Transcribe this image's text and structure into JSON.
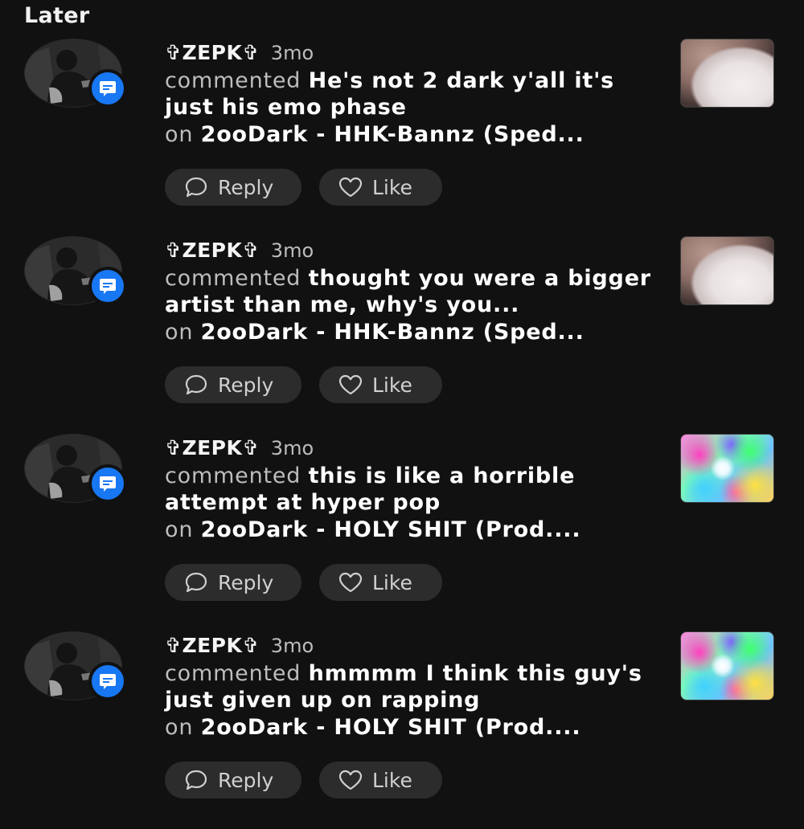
{
  "section": {
    "title": "Later"
  },
  "colors": {
    "background": "#111111",
    "badge": "#1877f2",
    "button_bg": "#2c2c2c",
    "muted_text": "#bdbdbd"
  },
  "notifications": [
    {
      "username": "✞ZEPK✞",
      "time": "3mo",
      "verb": "commented",
      "comment": "He's not 2 dark y'all it's just his emo phase",
      "on_word": "on",
      "track": "2ooDark - HHK-Bannz (Sped...",
      "reply_label": "Reply",
      "like_label": "Like",
      "thumbnail": "hand-on-white-object"
    },
    {
      "username": "✞ZEPK✞",
      "time": "3mo",
      "verb": "commented",
      "comment": "thought you were a bigger artist than me, why's you...",
      "on_word": "on",
      "track": "2ooDark - HHK-Bannz (Sped...",
      "reply_label": "Reply",
      "like_label": "Like",
      "thumbnail": "hand-on-white-object"
    },
    {
      "username": "✞ZEPK✞",
      "time": "3mo",
      "verb": "commented",
      "comment": "this is like a horrible attempt at hyper pop",
      "on_word": "on",
      "track": "2ooDark - HOLY SHIT (Prod....",
      "reply_label": "Reply",
      "like_label": "Like",
      "thumbnail": "psychedelic-swirl"
    },
    {
      "username": "✞ZEPK✞",
      "time": "3mo",
      "verb": "commented",
      "comment": "hmmmm I think this guy's just given up on rapping",
      "on_word": "on",
      "track": "2ooDark - HOLY SHIT (Prod....",
      "reply_label": "Reply",
      "like_label": "Like",
      "thumbnail": "psychedelic-swirl"
    }
  ]
}
